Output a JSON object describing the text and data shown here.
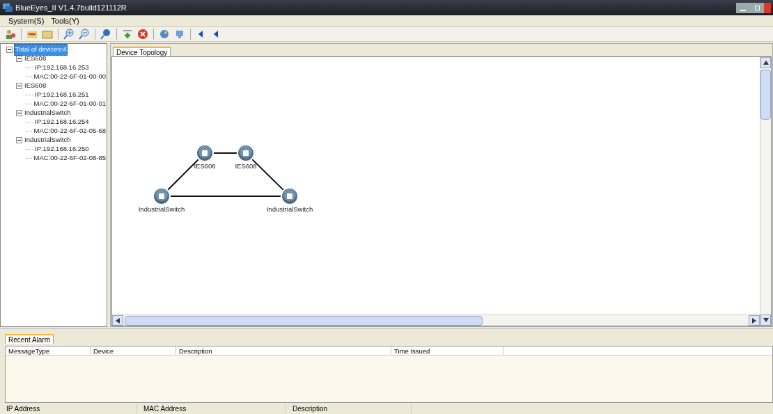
{
  "window": {
    "title": "BlueEyes_II V1.4.7build121112R"
  },
  "menu": [
    "System(S)",
    "Tools(Y)"
  ],
  "tree": {
    "label": "Total of devices:4",
    "selected": true,
    "expanded": true,
    "children": [
      {
        "label": "IES608",
        "expanded": true,
        "children": [
          {
            "label": "IP:192.168.16.253"
          },
          {
            "label": "MAC:00-22-6F-01-00-00"
          }
        ]
      },
      {
        "label": "IES608",
        "expanded": true,
        "children": [
          {
            "label": "IP:192.168.16.251"
          },
          {
            "label": "MAC:00-22-6F-01-00-01"
          }
        ]
      },
      {
        "label": "IndustrialSwitch",
        "expanded": true,
        "children": [
          {
            "label": "IP:192.168.16.254"
          },
          {
            "label": "MAC:00-22-6F-02-05-68"
          }
        ]
      },
      {
        "label": "IndustrialSwitch",
        "expanded": true,
        "children": [
          {
            "label": "IP:192.168.16.250"
          },
          {
            "label": "MAC:00-22-6F-02-08-85"
          }
        ]
      }
    ]
  },
  "main_tabs": [
    {
      "label": "Device Topology",
      "selected": true
    }
  ],
  "topology": {
    "nodes": [
      {
        "label": "IES608"
      },
      {
        "label": "IES608"
      },
      {
        "label": "IndustrialSwitch"
      },
      {
        "label": "IndustrialSwitch"
      }
    ]
  },
  "alarm_tabs": [
    {
      "label": "Recent Alarm",
      "selected": true
    }
  ],
  "alarm_table": {
    "columns": [
      "MessageType",
      "Device",
      "Description",
      "Time Issued"
    ]
  },
  "status_bar": [
    "IP Address",
    "MAC Address",
    "Description"
  ]
}
